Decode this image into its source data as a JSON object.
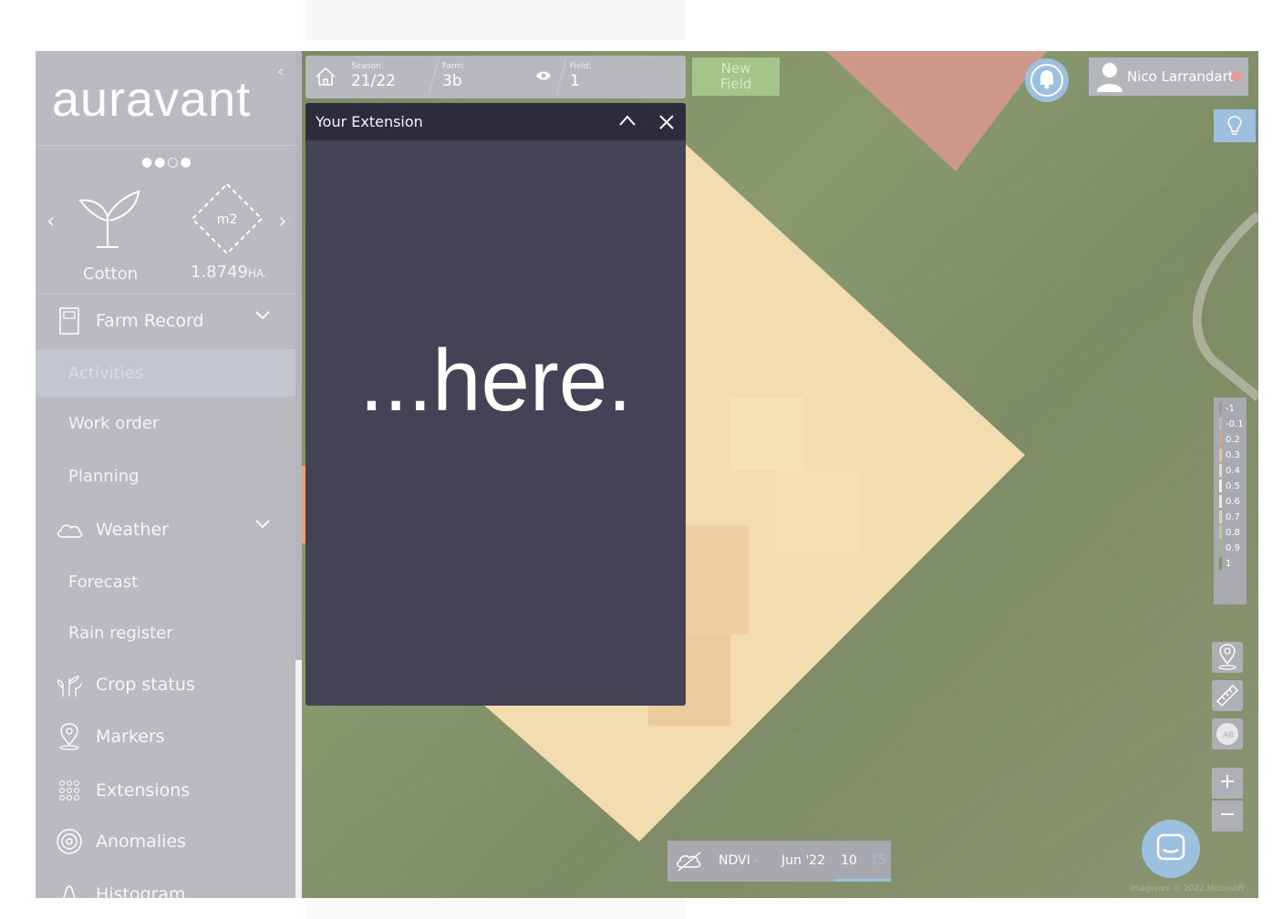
{
  "sidebar": {
    "logo": "auravant",
    "collapse_glyph": "‹",
    "card": {
      "crop_name": "Cotton",
      "area_value": "1.8749",
      "area_unit": "HA.",
      "area_icon_label": "m2",
      "pager": "●●○●",
      "prev_glyph": "‹",
      "next_glyph": "›"
    },
    "menu": {
      "farm_record": "Farm Record",
      "activities": "Activities",
      "work_order": "Work order",
      "planning": "Planning",
      "weather": "Weather",
      "forecast": "Forecast",
      "rain_register": "Rain register",
      "crop_status": "Crop status",
      "markers": "Markers",
      "extensions": "Extensions",
      "anomalies": "Anomalies",
      "histogram": "Histogram"
    }
  },
  "topbar": {
    "season_label": "Season:",
    "season_value": "21/22",
    "farm_label": "Farm:",
    "farm_value": "3b",
    "field_label": "Field:",
    "field_value": "1"
  },
  "new_field": {
    "line1": "New",
    "line2": "Field"
  },
  "user": {
    "name": "Nico Larrandart"
  },
  "panel": {
    "title": "Your Extension",
    "body": "...here."
  },
  "legend": [
    "-1",
    "-0.1",
    "0.2",
    "0.3",
    "0.4",
    "0.5",
    "0.6",
    "0.7",
    "0.8",
    "0.9",
    "1"
  ],
  "zoom": {
    "in": "+",
    "out": "−"
  },
  "bottombar": {
    "layer": "NDVI",
    "sep": "-",
    "month": "Jun '22",
    "day1": "10",
    "day2": "15"
  },
  "credit": "Imágenes © 2022 Microsoft",
  "colors": {
    "accent_blue": "#9cc0dd",
    "panel_bg": "#444255",
    "panel_header": "#2e2c3c",
    "sidebar_bg": "#b9bbc1"
  }
}
